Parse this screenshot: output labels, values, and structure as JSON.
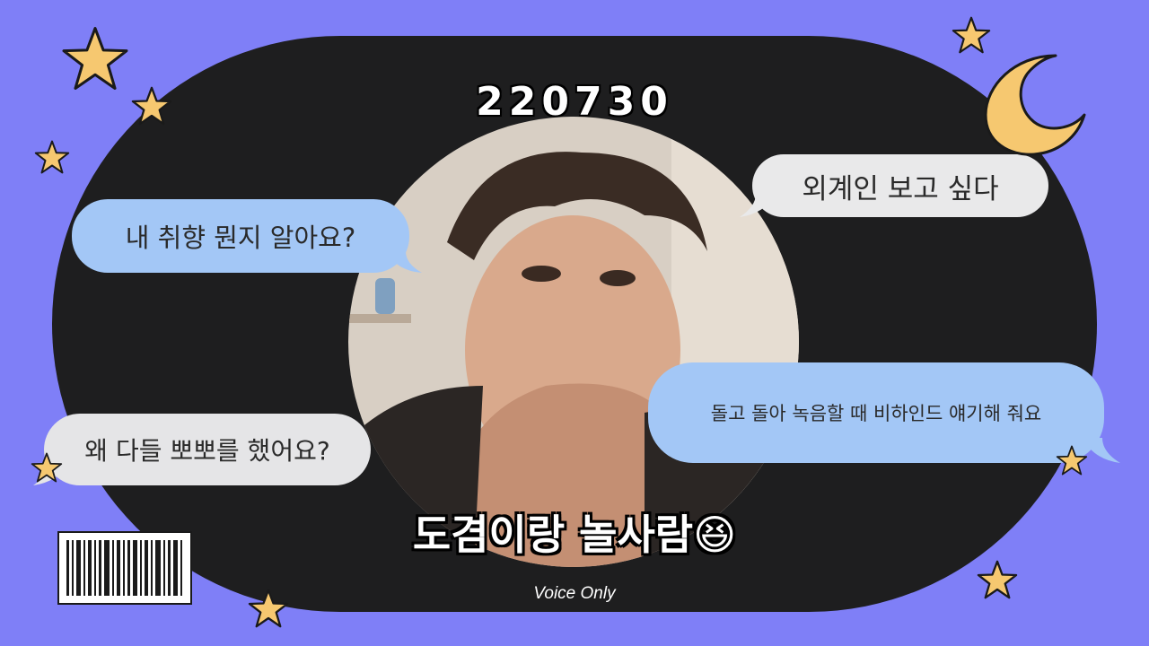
{
  "date_label": "220730",
  "bubbles": [
    {
      "text": "내 취향 뭔지 알아요?"
    },
    {
      "text": "외계인 보고 싶다"
    },
    {
      "text": "왜 다들 뽀뽀를 했어요?"
    },
    {
      "text": "돌고 돌아 녹음할 때 비하인드 얘기해 줘요"
    }
  ],
  "caption": "도겸이랑 놀사람",
  "emoji": "😆",
  "voice_label": "Voice Only",
  "colors": {
    "background": "#7f7ff7",
    "frame": "#1e1e1f",
    "bubble_blue": "#a3c7f6",
    "bubble_gray": "#e9e9ea",
    "star_fill": "#f6c870",
    "star_outline": "#1a1a1a"
  },
  "decorations": [
    "star-icon",
    "crescent-moon-icon",
    "barcode-icon",
    "laughing-emoji-icon"
  ]
}
